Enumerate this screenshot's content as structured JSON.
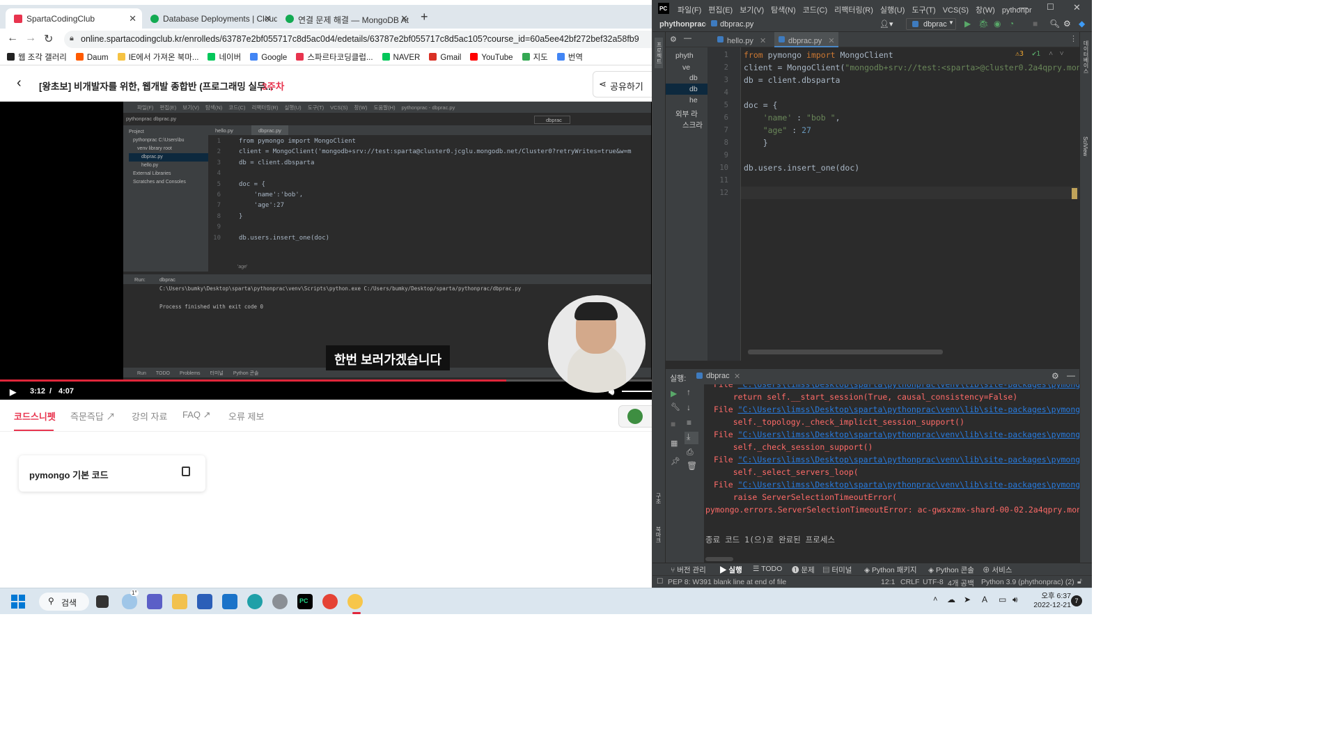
{
  "browser": {
    "tabs": [
      {
        "title": "SpartaCodingClub",
        "favicon_color": "#e8344e",
        "active": true
      },
      {
        "title": "Database Deployments | Cloud",
        "favicon_color": "#13aa52",
        "active": false
      },
      {
        "title": "연결 문제 해결 — MongoDB At",
        "favicon_color": "#13aa52",
        "active": false
      }
    ],
    "new_tab": "+",
    "url": "online.spartacodingclub.kr/enrolleds/63787e2bf055717c8d5ac0d4/edetails/63787e2bf055717c8d5ac105?course_id=60a5ee42bf272bef32a58fb9",
    "bookmarks": [
      {
        "label": "웹 조각 갤러리",
        "color": "#222"
      },
      {
        "label": "Daum",
        "color": "#ff5a00"
      },
      {
        "label": "IE에서 가져온 북마...",
        "color": "#f5c242"
      },
      {
        "label": "네이버",
        "color": "#03c75a"
      },
      {
        "label": "Google",
        "color": "#4285f4"
      },
      {
        "label": "스파르타코딩클럽...",
        "color": "#e8344e"
      },
      {
        "label": "NAVER",
        "color": "#03c75a"
      },
      {
        "label": "Gmail",
        "color": "#d93025"
      },
      {
        "label": "YouTube",
        "color": "#ff0000"
      },
      {
        "label": "지도",
        "color": "#34a853"
      },
      {
        "label": "번역",
        "color": "#4285f4"
      }
    ]
  },
  "course": {
    "title": "[왕초보] 비개발자를 위한, 웹개발 종합반 (프로그래밍 실무...",
    "week": "3주차",
    "share_label": "공유하기"
  },
  "video": {
    "subtitle": "한번 보러가겠습니다",
    "current_time": "3:12",
    "separator": "/",
    "duration": "4:07",
    "progress": 0.777,
    "inner_menu": [
      "파일(F)",
      "편집(E)",
      "보기(V)",
      "탐색(N)",
      "코드(C)",
      "리팩터링(R)",
      "실행(U)",
      "도구(T)",
      "VCS(S)",
      "창(W)",
      "도움말(H)",
      "pythonprac - dbprac.py"
    ],
    "inner_crumb": "pythonprac  dbprac.py",
    "inner_tabs": [
      "hello.py",
      "dbprac.py"
    ],
    "inner_run_config": "dbprac",
    "inner_project": [
      "Project",
      "pythonprac  C:\\Users\\bu",
      "venv  library root",
      "dbprac.py",
      "hello.py",
      "External Libraries",
      "Scratches and Consoles"
    ],
    "inner_code": [
      {
        "n": "1",
        "t": "from pymongo import MongoClient"
      },
      {
        "n": "2",
        "t": "client = MongoClient('mongodb+srv://test:sparta@cluster0.jcglu.mongodb.net/Cluster0?retryWrites=true&w=m"
      },
      {
        "n": "3",
        "t": "db = client.dbsparta"
      },
      {
        "n": "4",
        "t": ""
      },
      {
        "n": "5",
        "t": "doc = {"
      },
      {
        "n": "6",
        "t": "    'name':'bob',"
      },
      {
        "n": "7",
        "t": "    'age':27"
      },
      {
        "n": "8",
        "t": "}"
      },
      {
        "n": "9",
        "t": ""
      },
      {
        "n": "10",
        "t": "db.users.insert_one(doc)"
      }
    ],
    "inner_warnings": "⚠3",
    "inner_hint": "'age'",
    "inner_run_label": "Run:",
    "inner_run_tab": "dbprac",
    "inner_run_cmd": "C:\\Users\\bumky\\Desktop\\sparta\\pythonprac\\venv\\Scripts\\python.exe C:/Users/bumky/Desktop/sparta/pythonprac/dbprac.py",
    "inner_run_result": "Process finished with exit code 0",
    "inner_bottom": [
      "Run",
      "TODO",
      "Problems",
      "터미널",
      "Python 콘솔"
    ]
  },
  "lecture_tabs": [
    {
      "label": "코드스니펫",
      "active": true,
      "ext": false
    },
    {
      "label": "즉문즉답",
      "active": false,
      "ext": true
    },
    {
      "label": "강의 자료",
      "active": false,
      "ext": false
    },
    {
      "label": "FAQ",
      "active": false,
      "ext": true
    },
    {
      "label": "오류 제보",
      "active": false,
      "ext": false
    }
  ],
  "snippet": {
    "title": "pymongo 기본 코드"
  },
  "ide": {
    "badge": "PC",
    "menu": [
      "파일(F)",
      "편집(E)",
      "보기(V)",
      "탐색(N)",
      "코드(C)",
      "리팩터링(R)",
      "실행(U)",
      "도구(T)",
      "VCS(S)",
      "창(W)",
      "pythonpr"
    ],
    "breadcrumb": [
      "phythonprac",
      "dbprac.py"
    ],
    "run_config": "dbprac",
    "project_items": [
      "phyth",
      "ve",
      "db",
      "db",
      "he",
      "외부 라",
      "스크라"
    ],
    "tabs": [
      {
        "label": "hello.py",
        "active": false
      },
      {
        "label": "dbprac.py",
        "active": true
      }
    ],
    "inspection": {
      "warnings": "3",
      "ok": "1"
    },
    "code_lines": [
      [
        {
          "t": "from ",
          "c": "kw"
        },
        {
          "t": "pymongo ",
          "c": "id"
        },
        {
          "t": "import ",
          "c": "kw"
        },
        {
          "t": "MongoClient",
          "c": "id"
        }
      ],
      [
        {
          "t": "client = MongoClient(",
          "c": "id"
        },
        {
          "t": "\"mongodb+srv://test:<sparta>@cluster0.2a4qpry.mongodb",
          "c": "str"
        }
      ],
      [
        {
          "t": "db = client.dbsparta",
          "c": "id"
        }
      ],
      [],
      [
        {
          "t": "doc = {",
          "c": "id"
        }
      ],
      [
        {
          "t": "    ",
          "c": "id"
        },
        {
          "t": "'name'",
          "c": "str"
        },
        {
          "t": " : ",
          "c": "id"
        },
        {
          "t": "\"bob \"",
          "c": "str"
        },
        {
          "t": ",",
          "c": "id"
        }
      ],
      [
        {
          "t": "    ",
          "c": "id"
        },
        {
          "t": "\"age\"",
          "c": "str"
        },
        {
          "t": " : ",
          "c": "id"
        },
        {
          "t": "27",
          "c": "num"
        }
      ],
      [
        {
          "t": "    }",
          "c": "id"
        }
      ],
      [],
      [
        {
          "t": "db.users.insert_one(doc)",
          "c": "id"
        }
      ],
      [],
      []
    ],
    "run_label": "실행:",
    "run_tab": "dbprac",
    "output": [
      {
        "type": "file",
        "prefix": "File ",
        "link": "\"C:\\Users\\limss\\Desktop\\sparta\\pythonprac\\venv\\lib\\site-packages\\pymongo\\mo"
      },
      {
        "type": "code",
        "text": "    return self.__start_session(True, causal_consistency=False)"
      },
      {
        "type": "file",
        "prefix": "File ",
        "link": "\"C:\\Users\\limss\\Desktop\\sparta\\pythonprac\\venv\\lib\\site-packages\\pymongo\\mo"
      },
      {
        "type": "code",
        "text": "    self._topology._check_implicit_session_support()"
      },
      {
        "type": "file",
        "prefix": "File ",
        "link": "\"C:\\Users\\limss\\Desktop\\sparta\\pythonprac\\venv\\lib\\site-packages\\pymongo\\to"
      },
      {
        "type": "code",
        "text": "    self._check_session_support()"
      },
      {
        "type": "file",
        "prefix": "File ",
        "link": "\"C:\\Users\\limss\\Desktop\\sparta\\pythonprac\\venv\\lib\\site-packages\\pymongo\\to"
      },
      {
        "type": "code",
        "text": "    self._select_servers_loop("
      },
      {
        "type": "file",
        "prefix": "File ",
        "link": "\"C:\\Users\\limss\\Desktop\\sparta\\pythonprac\\venv\\lib\\site-packages\\pymongo\\to"
      },
      {
        "type": "code",
        "text": "    raise ServerSelectionTimeoutError("
      },
      {
        "type": "error",
        "text": "pymongo.errors.ServerSelectionTimeoutError: ac-gwsxzmx-shard-00-02.2a4qpry.mongodb"
      },
      {
        "type": "blank",
        "text": ""
      },
      {
        "type": "info",
        "text": "종료 코드 1(으)로 완료된 프로세스"
      }
    ],
    "bottom_tabs": [
      "버전 관리",
      "실행",
      "TODO",
      "문제",
      "터미널",
      "Python 패키지",
      "Python 콘솔",
      "서비스"
    ],
    "status": {
      "message": "PEP 8: W391 blank line at end of file",
      "position": "12:1",
      "line_sep": "CRLF",
      "encoding": "UTF-8",
      "indent": "4개 공백",
      "interpreter": "Python 3.9 (phythonprac) (2)"
    },
    "side_labels": {
      "left_top": "프로젝트",
      "left_bottom1": "구조",
      "left_bottom2": "북마크",
      "right1": "데이터베이스",
      "right2": "SciView"
    }
  },
  "taskbar": {
    "search_label": "검색",
    "weather_badge": "1°",
    "time": "오후 6:37",
    "date": "2022-12-21",
    "notif": "7"
  },
  "colors": {
    "accent": "#e8344e",
    "ide_bg": "#2b2b2b",
    "keyword": "#cc7832",
    "string": "#6a8759",
    "number": "#6897bb",
    "error": "#ff6b68",
    "link": "#287bde"
  }
}
